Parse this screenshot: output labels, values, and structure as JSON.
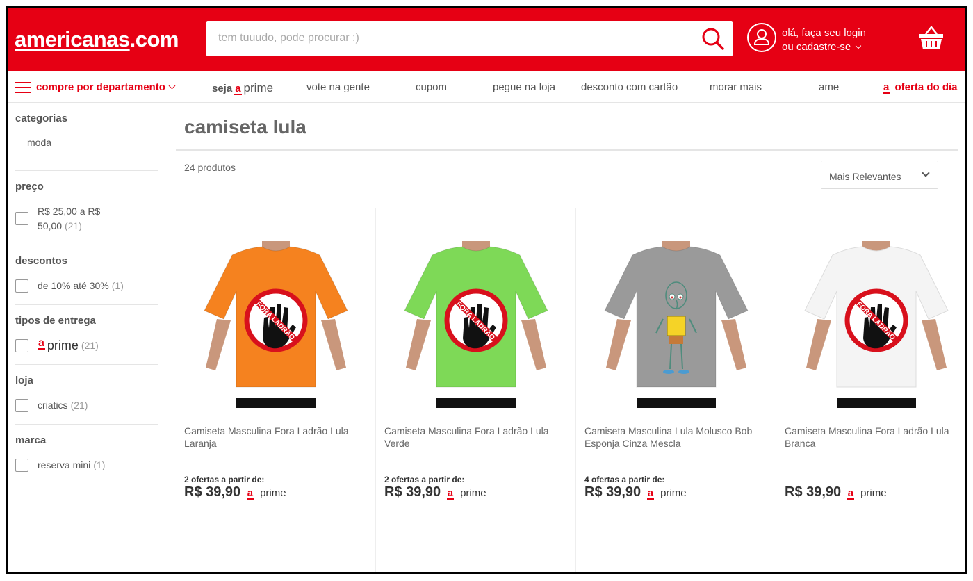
{
  "header": {
    "logo_main": "americanas",
    "logo_domain": ".com",
    "search_placeholder": "tem tuuudo, pode procurar :)",
    "login_line1": "olá, faça seu login",
    "login_line2": "ou cadastre-se",
    "brand_color": "#e60014"
  },
  "nav": {
    "department": "compre por departamento",
    "seja": "seja",
    "a_badge": "a",
    "prime": "prime",
    "items": [
      "vote na gente",
      "cupom",
      "pegue na loja",
      "desconto com cartão",
      "morar mais",
      "ame"
    ],
    "offer": "oferta do dia"
  },
  "sidebar": {
    "categories": {
      "title": "categorias",
      "item": "moda"
    },
    "price": {
      "title": "preço",
      "option": "R$ 25,00 a R$ 50,00",
      "count": "(21)"
    },
    "discounts": {
      "title": "descontos",
      "option": "de 10% até 30%",
      "count": "(1)"
    },
    "delivery": {
      "title": "tipos de entrega",
      "badge": "a",
      "option": "prime",
      "count": "(21)"
    },
    "store": {
      "title": "loja",
      "option": "criatics",
      "count": "(21)"
    },
    "brand": {
      "title": "marca",
      "option": "reserva mini",
      "count": "(1)"
    }
  },
  "main": {
    "title": "camiseta lula",
    "count": "24 produtos",
    "sort": "Mais Relevantes"
  },
  "products": [
    {
      "name": "Camiseta Masculina Fora Ladrão Lula Laranja",
      "offers": "2 ofertas a partir de:",
      "price": "R$ 39,90",
      "badge": "a",
      "prime": "prime",
      "shirt_color": "#f5821f",
      "graphic": "fora-ladrao",
      "sign_text": "FORA LADRÃO"
    },
    {
      "name": "Camiseta Masculina Fora Ladrão Lula Verde",
      "offers": "2 ofertas a partir de:",
      "price": "R$ 39,90",
      "badge": "a",
      "prime": "prime",
      "shirt_color": "#7ed957",
      "graphic": "fora-ladrao",
      "sign_text": "FORA LADRÃO"
    },
    {
      "name": "Camiseta Masculina Lula Molusco Bob Esponja Cinza Mescla",
      "offers": "4 ofertas a partir de:",
      "price": "R$ 39,90",
      "badge": "a",
      "prime": "prime",
      "shirt_color": "#9a9a9a",
      "graphic": "squidward",
      "sign_text": ""
    },
    {
      "name": "Camiseta Masculina Fora Ladrão Lula Branca",
      "offers": "",
      "price": "R$ 39,90",
      "badge": "a",
      "prime": "prime",
      "shirt_color": "#f4f4f4",
      "graphic": "fora-ladrao",
      "sign_text": "FORA LADRÃO"
    }
  ]
}
